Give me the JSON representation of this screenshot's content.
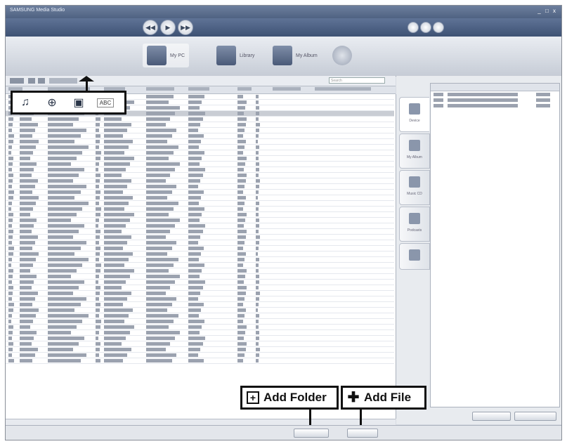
{
  "window": {
    "title": "SAMSUNG Media Studio",
    "controls": "_ □ x"
  },
  "navigation": {
    "tabs": [
      {
        "label": "My PC",
        "icon": "my-pc-icon"
      },
      {
        "label": "Library",
        "icon": "library-icon"
      },
      {
        "label": "My Album",
        "icon": "album-icon"
      },
      {
        "label": "",
        "icon": "disc-icon"
      }
    ]
  },
  "toolbar": {
    "search_placeholder": "Search"
  },
  "device_panel": {
    "tabs": [
      {
        "label": "Device",
        "icon": "device-icon"
      },
      {
        "label": "My Album",
        "icon": "album-icon"
      },
      {
        "label": "Music CD",
        "icon": "cd-icon"
      },
      {
        "label": "Podcasts",
        "icon": "podcast-icon"
      },
      {
        "label": "",
        "icon": "sync-icon"
      }
    ]
  },
  "view_icons": {
    "icons": [
      "music-view-icon",
      "globe-icon",
      "album-view-icon",
      "keypad-icon"
    ]
  },
  "callouts": {
    "add_folder_label": "Add Folder",
    "add_file_label": "Add File"
  },
  "colors": {
    "accent": "#4f6282",
    "highlight": "#111111"
  }
}
